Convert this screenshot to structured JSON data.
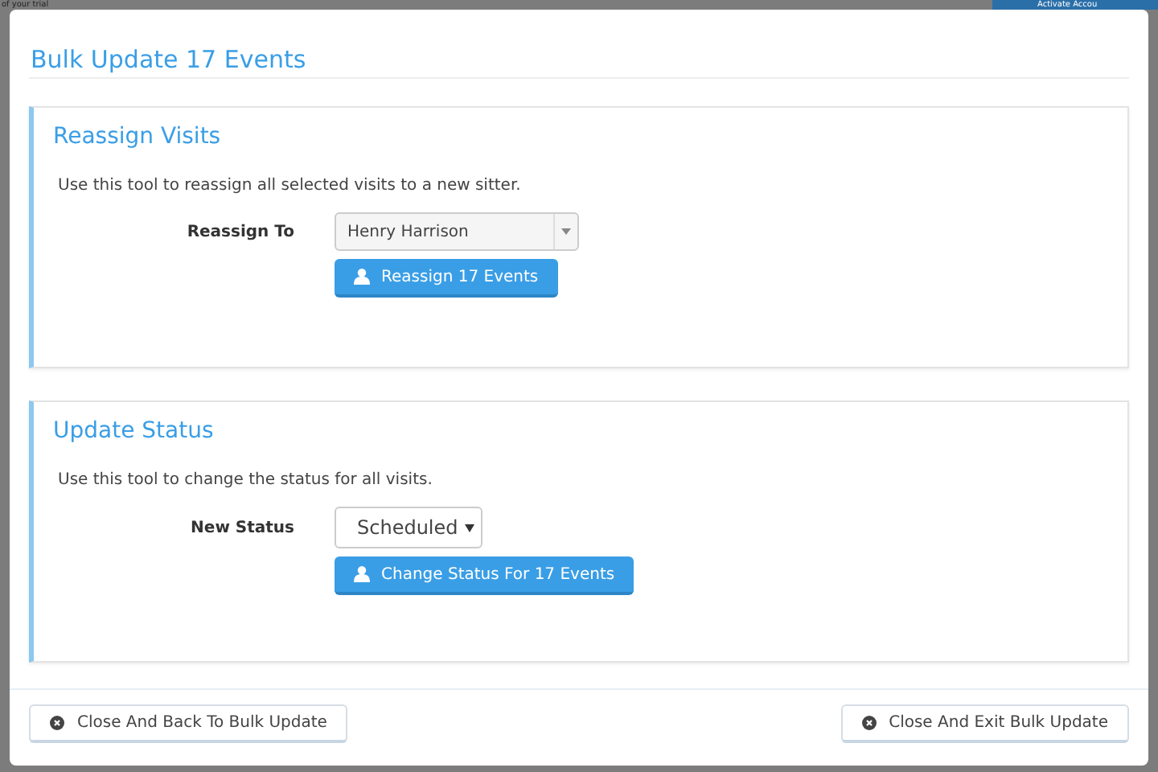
{
  "background": {
    "notice": "of your trial",
    "activate_button": "Activate Accou"
  },
  "modal": {
    "title": "Bulk Update 17 Events",
    "sections": [
      {
        "kind": "dropdown",
        "title": "Reassign Visits",
        "description": "Use this tool to reassign all selected visits to a new sitter.",
        "field_label": "Reassign To",
        "value": "Henry Harrison",
        "button": "Reassign 17 Events"
      },
      {
        "kind": "select",
        "title": "Update Status",
        "description": "Use this tool to change the status for all visits.",
        "field_label": "New Status",
        "value": "Scheduled",
        "button": "Change Status For 17 Events"
      }
    ],
    "footer_buttons": [
      "Close And Back To Bulk Update",
      "Close And Exit Bulk Update"
    ]
  }
}
